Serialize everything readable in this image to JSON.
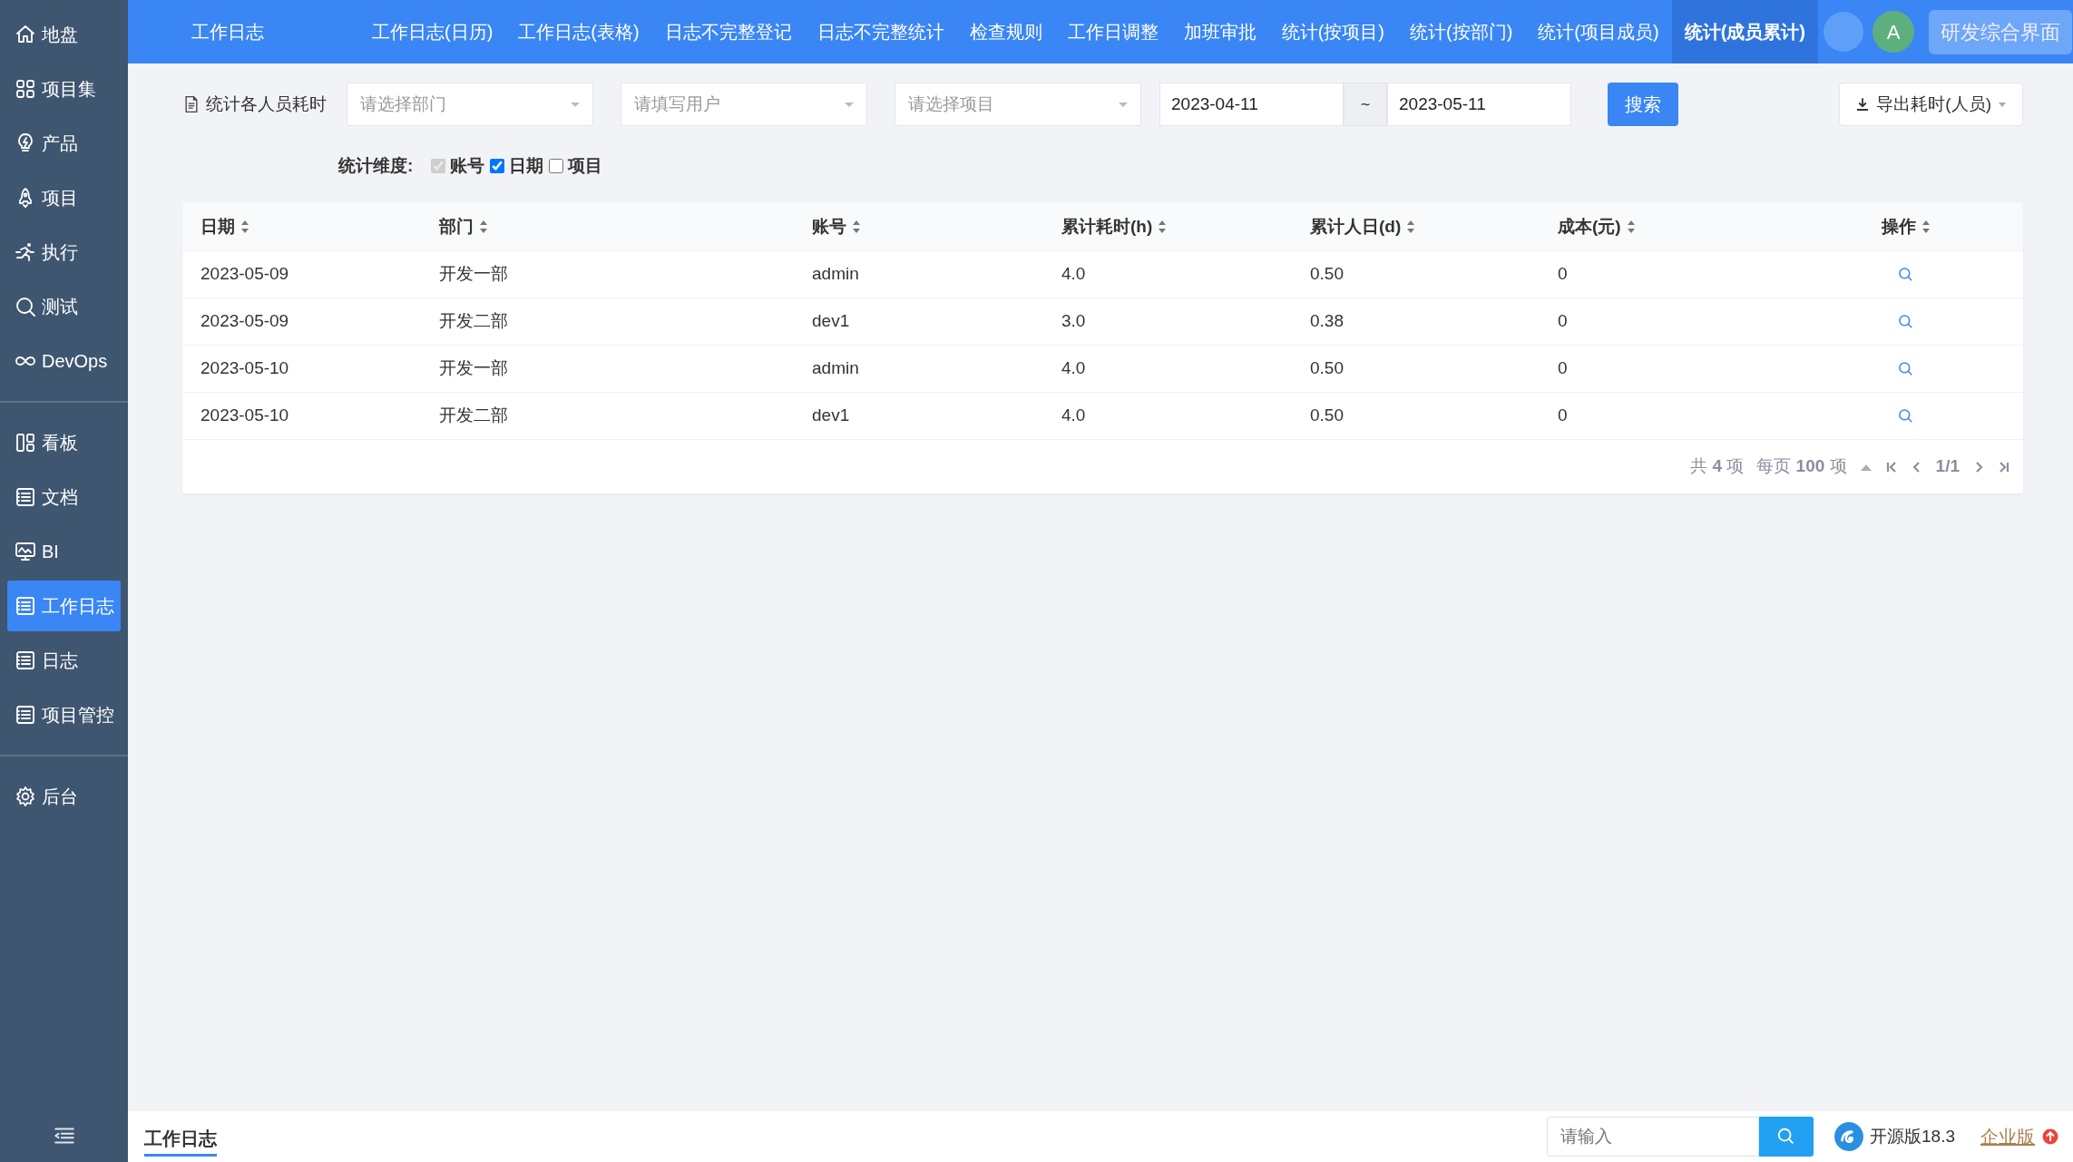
{
  "sidebar": {
    "groups": [
      [
        {
          "label": "地盘",
          "selected": false
        },
        {
          "label": "项目集",
          "selected": false
        },
        {
          "label": "产品",
          "selected": false
        },
        {
          "label": "项目",
          "selected": false
        },
        {
          "label": "执行",
          "selected": false
        },
        {
          "label": "测试",
          "selected": false
        },
        {
          "label": "DevOps",
          "selected": false
        }
      ],
      [
        {
          "label": "看板",
          "selected": false
        },
        {
          "label": "文档",
          "selected": false
        },
        {
          "label": "BI",
          "selected": false
        },
        {
          "label": "工作日志",
          "selected": true
        },
        {
          "label": "日志",
          "selected": false
        },
        {
          "label": "项目管控",
          "selected": false
        }
      ],
      [
        {
          "label": "后台",
          "selected": false
        }
      ]
    ]
  },
  "top_nav": {
    "title": "工作日志",
    "tabs": [
      {
        "label": "工作日志(日历)",
        "selected": false
      },
      {
        "label": "工作日志(表格)",
        "selected": false
      },
      {
        "label": "日志不完整登记",
        "selected": false
      },
      {
        "label": "日志不完整统计",
        "selected": false
      },
      {
        "label": "检查规则",
        "selected": false
      },
      {
        "label": "工作日调整",
        "selected": false
      },
      {
        "label": "加班审批",
        "selected": false
      },
      {
        "label": "统计(按项目)",
        "selected": false
      },
      {
        "label": "统计(按部门)",
        "selected": false
      },
      {
        "label": "统计(项目成员)",
        "selected": false
      },
      {
        "label": "统计(成员累计)",
        "selected": true
      }
    ],
    "avatar": "A",
    "switch_button": "研发综合界面"
  },
  "filter": {
    "title": "统计各人员耗时",
    "department": {
      "placeholder": "请选择部门"
    },
    "user": {
      "placeholder": "请填写用户"
    },
    "project": {
      "placeholder": "请选择项目"
    },
    "date_from": "2023-04-11",
    "date_separator": "~",
    "date_to": "2023-05-11",
    "search_button": "搜索",
    "export_button": "导出耗时(人员)"
  },
  "dimensions": {
    "label": "统计维度:",
    "options": [
      {
        "label": "账号",
        "checked": true,
        "disabled": true
      },
      {
        "label": "日期",
        "checked": true,
        "disabled": false
      },
      {
        "label": "项目",
        "checked": false,
        "disabled": false
      }
    ]
  },
  "table": {
    "columns": [
      "日期",
      "部门",
      "账号",
      "累计耗时(h)",
      "累计人日(d)",
      "成本(元)",
      "操作"
    ],
    "rows": [
      [
        "2023-05-09",
        "开发一部",
        "admin",
        "4.0",
        "0.50",
        "0"
      ],
      [
        "2023-05-09",
        "开发二部",
        "dev1",
        "3.0",
        "0.38",
        "0"
      ],
      [
        "2023-05-10",
        "开发一部",
        "admin",
        "4.0",
        "0.50",
        "0"
      ],
      [
        "2023-05-10",
        "开发二部",
        "dev1",
        "4.0",
        "0.50",
        "0"
      ]
    ]
  },
  "pagination": {
    "total": "共 **4** 项",
    "per_page": "每页 **100** 项",
    "page": "1/1"
  },
  "footer": {
    "tab": "工作日志",
    "search": {
      "placeholder": "请输入"
    },
    "edition": "开源版18.3",
    "enterprise": "企业版"
  }
}
